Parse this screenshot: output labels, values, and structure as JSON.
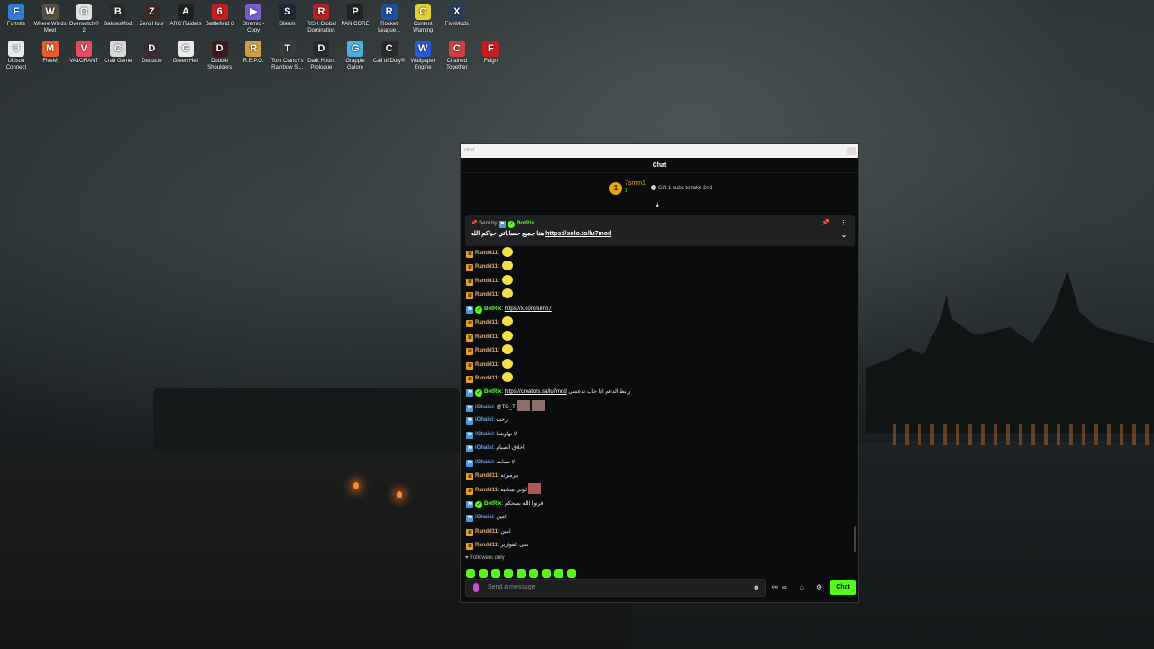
{
  "desktop": {
    "row1": [
      {
        "label": "Fortnite",
        "color": "#2f7fd8",
        "glyph": "F"
      },
      {
        "label": "Where Winds Meet",
        "color": "#5a5040",
        "glyph": "W"
      },
      {
        "label": "Overwatch® 2",
        "color": "#e2e2e2",
        "glyph": "O"
      },
      {
        "label": "BakkesMod",
        "color": "#2a2a2a",
        "glyph": "B"
      },
      {
        "label": "Zero Hour",
        "color": "#3a2a2a",
        "glyph": "Z"
      },
      {
        "label": "ARC Raiders",
        "color": "#1f1f1f",
        "glyph": "A"
      },
      {
        "label": "Battlefield 6",
        "color": "#c81e1e",
        "glyph": "6"
      },
      {
        "label": "Stremio - Copy",
        "color": "#7b5bd6",
        "glyph": "▶"
      },
      {
        "label": "Steam",
        "color": "#1b2838",
        "glyph": "S"
      },
      {
        "label": "RISK Global Domination",
        "color": "#b22222",
        "glyph": "R"
      },
      {
        "label": "PANICORE",
        "color": "#222",
        "glyph": "P"
      },
      {
        "label": "Rocket League...",
        "color": "#1e4fa0",
        "glyph": "R"
      },
      {
        "label": "Content Warning",
        "color": "#e0d030",
        "glyph": "C"
      },
      {
        "label": "FiveMods",
        "color": "#2a3a5a",
        "glyph": "X"
      }
    ],
    "row2": [
      {
        "label": "Ubisoft Connect",
        "color": "#eaeaea",
        "glyph": "U"
      },
      {
        "label": "FiveM",
        "color": "#f05a28",
        "glyph": "M"
      },
      {
        "label": "VALORANT",
        "color": "#e84a5f",
        "glyph": "V"
      },
      {
        "label": "Crab Game",
        "color": "#d8d8d8",
        "glyph": "C"
      },
      {
        "label": "Deducto",
        "color": "#3a2a3a",
        "glyph": "D"
      },
      {
        "label": "Green Hell",
        "color": "#eaeaea",
        "glyph": "G"
      },
      {
        "label": "Double Shoulders",
        "color": "#3a1a1a",
        "glyph": "D"
      },
      {
        "label": "R.E.P.O.",
        "color": "#d0a040",
        "glyph": "R"
      },
      {
        "label": "Tom Clancy's Rainbow Si...",
        "color": "#3a3a3a",
        "glyph": "T"
      },
      {
        "label": "Dark Hours Prologue",
        "color": "#2a2a2a",
        "glyph": "D"
      },
      {
        "label": "Grapple Galore",
        "color": "#4ab0e0",
        "glyph": "G"
      },
      {
        "label": "Call of Duty®",
        "color": "#2a2a2a",
        "glyph": "C"
      },
      {
        "label": "Wallpaper Engine",
        "color": "#2a5ad8",
        "glyph": "W"
      },
      {
        "label": "Chained Together",
        "color": "#d04040",
        "glyph": "C"
      },
      {
        "label": "Feign",
        "color": "#c81e1e",
        "glyph": "F"
      }
    ]
  },
  "window": {
    "titlebar": "chat",
    "header": "Chat"
  },
  "goal": {
    "coin": "1",
    "user": "7smm1",
    "count": "1",
    "text": "Gift 1 subs to take 2nd"
  },
  "pinned": {
    "sent_by_label": "Sent by",
    "sent_by_name": "BotRix",
    "message_text": "هنا جميع حساباتي حياكم الله",
    "message_link": "https://solo.to/lu7mod"
  },
  "messages": [
    {
      "user": "Randd11",
      "type": "randd",
      "text": "",
      "link": "",
      "emote": "yellow"
    },
    {
      "user": "Randd11",
      "type": "randd",
      "text": "",
      "link": "",
      "emote": "yellow"
    },
    {
      "user": "Randd11",
      "type": "randd",
      "text": "",
      "link": "",
      "emote": "yellow"
    },
    {
      "user": "Randd11",
      "type": "randd",
      "text": "",
      "link": "",
      "emote": "yellow"
    },
    {
      "user": "BotRix",
      "type": "bot",
      "text": "",
      "link": "https://x.com/lumo7",
      "emote": ""
    },
    {
      "user": "Randd11",
      "type": "randd",
      "text": "",
      "link": "",
      "emote": "yellow"
    },
    {
      "user": "Randd11",
      "type": "randd",
      "text": "",
      "link": "",
      "emote": "yellow"
    },
    {
      "user": "Randd11",
      "type": "randd",
      "text": "",
      "link": "",
      "emote": "yellow"
    },
    {
      "user": "Randd11",
      "type": "randd",
      "text": "",
      "link": "",
      "emote": "yellow"
    },
    {
      "user": "Randd11",
      "type": "randd",
      "text": "",
      "link": "",
      "emote": "yellow"
    },
    {
      "user": "BotRix",
      "type": "bot",
      "text": "رابط الدعم اذا حاب تدعمني",
      "link": "https://creators.sa/lu7mod",
      "emote": ""
    },
    {
      "user": "iGhaisi",
      "type": "ghaisi",
      "text": "@TG_T",
      "link": "",
      "emote": "image"
    },
    {
      "user": "iGhaisi",
      "type": "ghaisi",
      "text": "ارحب",
      "link": "",
      "emote": ""
    },
    {
      "user": "iGhaisi",
      "type": "ghaisi",
      "text": "لا تهاوشنا",
      "link": "",
      "emote": ""
    },
    {
      "user": "iGhaisi",
      "type": "ghaisi",
      "text": "اخلاق الصيام",
      "link": "",
      "emote": ""
    },
    {
      "user": "iGhaisi",
      "type": "ghaisi",
      "text": "لا تسابنه",
      "link": "",
      "emote": ""
    },
    {
      "user": "Randd11",
      "type": "randd",
      "text": "مرميرنه",
      "link": "",
      "emote": ""
    },
    {
      "user": "Randd11",
      "type": "randd",
      "text": "لوتي ستانيه",
      "link": "",
      "emote": "image2"
    },
    {
      "user": "BotRix",
      "type": "bot",
      "text": "فرتوا الله بصحكم",
      "link": "",
      "emote": ""
    },
    {
      "user": "iGhaisi",
      "type": "ghaisi",
      "text": "امين",
      "link": "",
      "emote": ""
    },
    {
      "user": "Randd11",
      "type": "randd",
      "text": "امين",
      "link": "",
      "emote": ""
    },
    {
      "user": "Randd11",
      "type": "randd",
      "text": "متى الفوازير",
      "link": "",
      "emote": ""
    }
  ],
  "followers_only": "Followers only",
  "input": {
    "placeholder": "Send a message"
  },
  "send_label": "Chat",
  "colors": {
    "accent": "#53fc18",
    "panel": "#0b0c0d",
    "randd": "#e0b070",
    "ghaisi": "#6aa3e0"
  }
}
